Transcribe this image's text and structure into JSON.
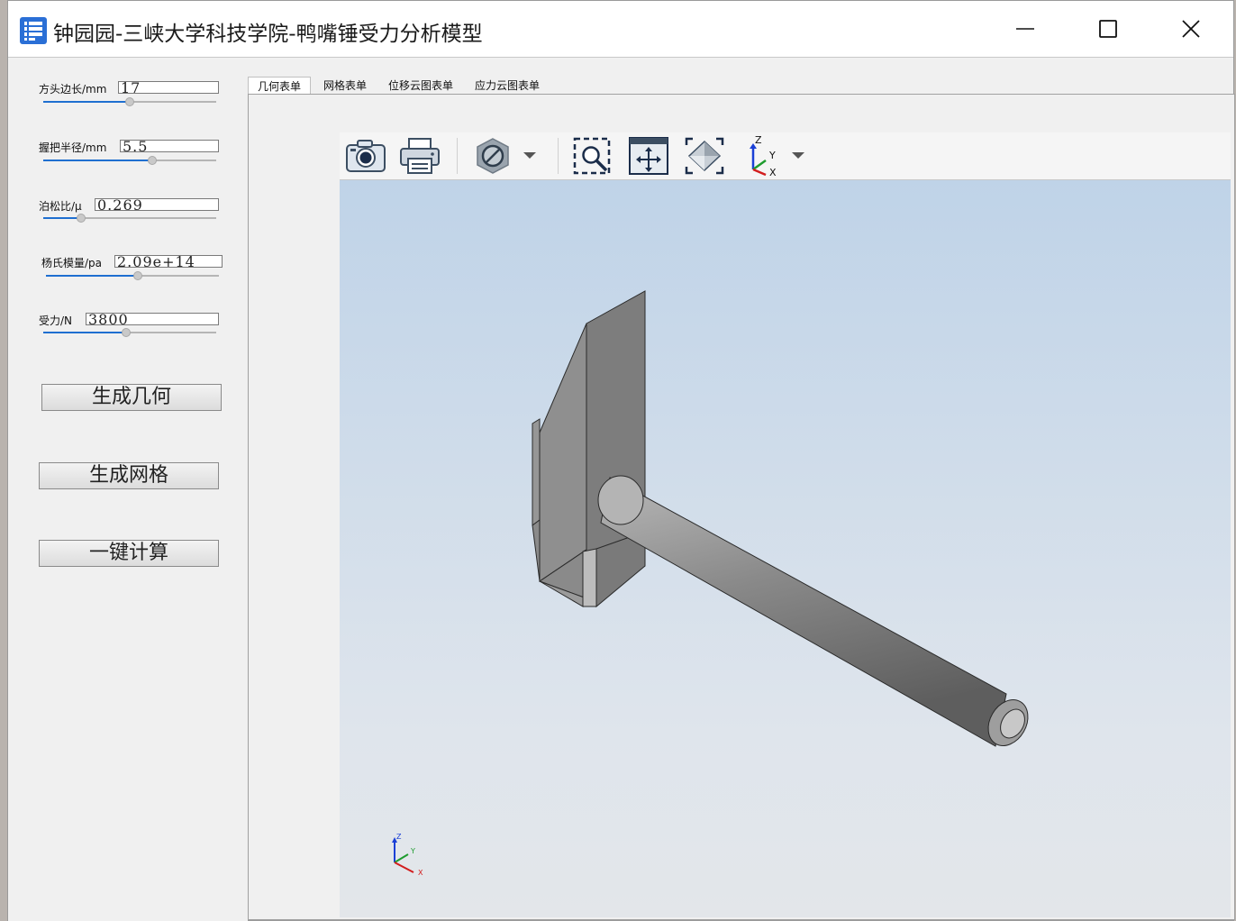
{
  "window": {
    "title": "钟园园-三峡大学科技学院-鸭嘴锤受力分析模型",
    "controls": [
      "minimize-icon",
      "maximize-icon",
      "close-icon"
    ]
  },
  "params": [
    {
      "label": "方头边长/mm",
      "value": "17",
      "slider_fraction": 0.5
    },
    {
      "label": "握把半径/mm",
      "value": "5.5",
      "slider_fraction": 0.63
    },
    {
      "label": "泊松比/μ",
      "value": "0.269",
      "slider_fraction": 0.22
    },
    {
      "label": "杨氏模量/pa",
      "value": "2.09e+14",
      "slider_fraction": 0.53
    },
    {
      "label": "受力/N",
      "value": "3800",
      "slider_fraction": 0.48
    }
  ],
  "buttons": {
    "generate_geometry": "生成几何",
    "generate_mesh": "生成网格",
    "compute": "一键计算"
  },
  "tabs": [
    {
      "label": "几何表单",
      "active": true
    },
    {
      "label": "网格表单",
      "active": false
    },
    {
      "label": "位移云图表单",
      "active": false
    },
    {
      "label": "应力云图表单",
      "active": false
    }
  ],
  "toolbar": {
    "icons": [
      "camera-icon",
      "print-icon",
      "no-entry-icon",
      "dropdown-icon",
      "zoom-area-icon",
      "pan-icon",
      "fit-all-icon",
      "axis-view-icon",
      "dropdown-icon"
    ],
    "axis_labels": [
      "Z",
      "Y",
      "X"
    ]
  },
  "viewport": {
    "model": "hammer-model",
    "triad_labels": [
      "Z",
      "Y",
      "X"
    ]
  },
  "colors": {
    "accent": "#1f6fd0",
    "viewport_top": "#bfd3e8",
    "viewport_bottom": "#e3e6ea",
    "model_gray": "#8c8c8c"
  }
}
